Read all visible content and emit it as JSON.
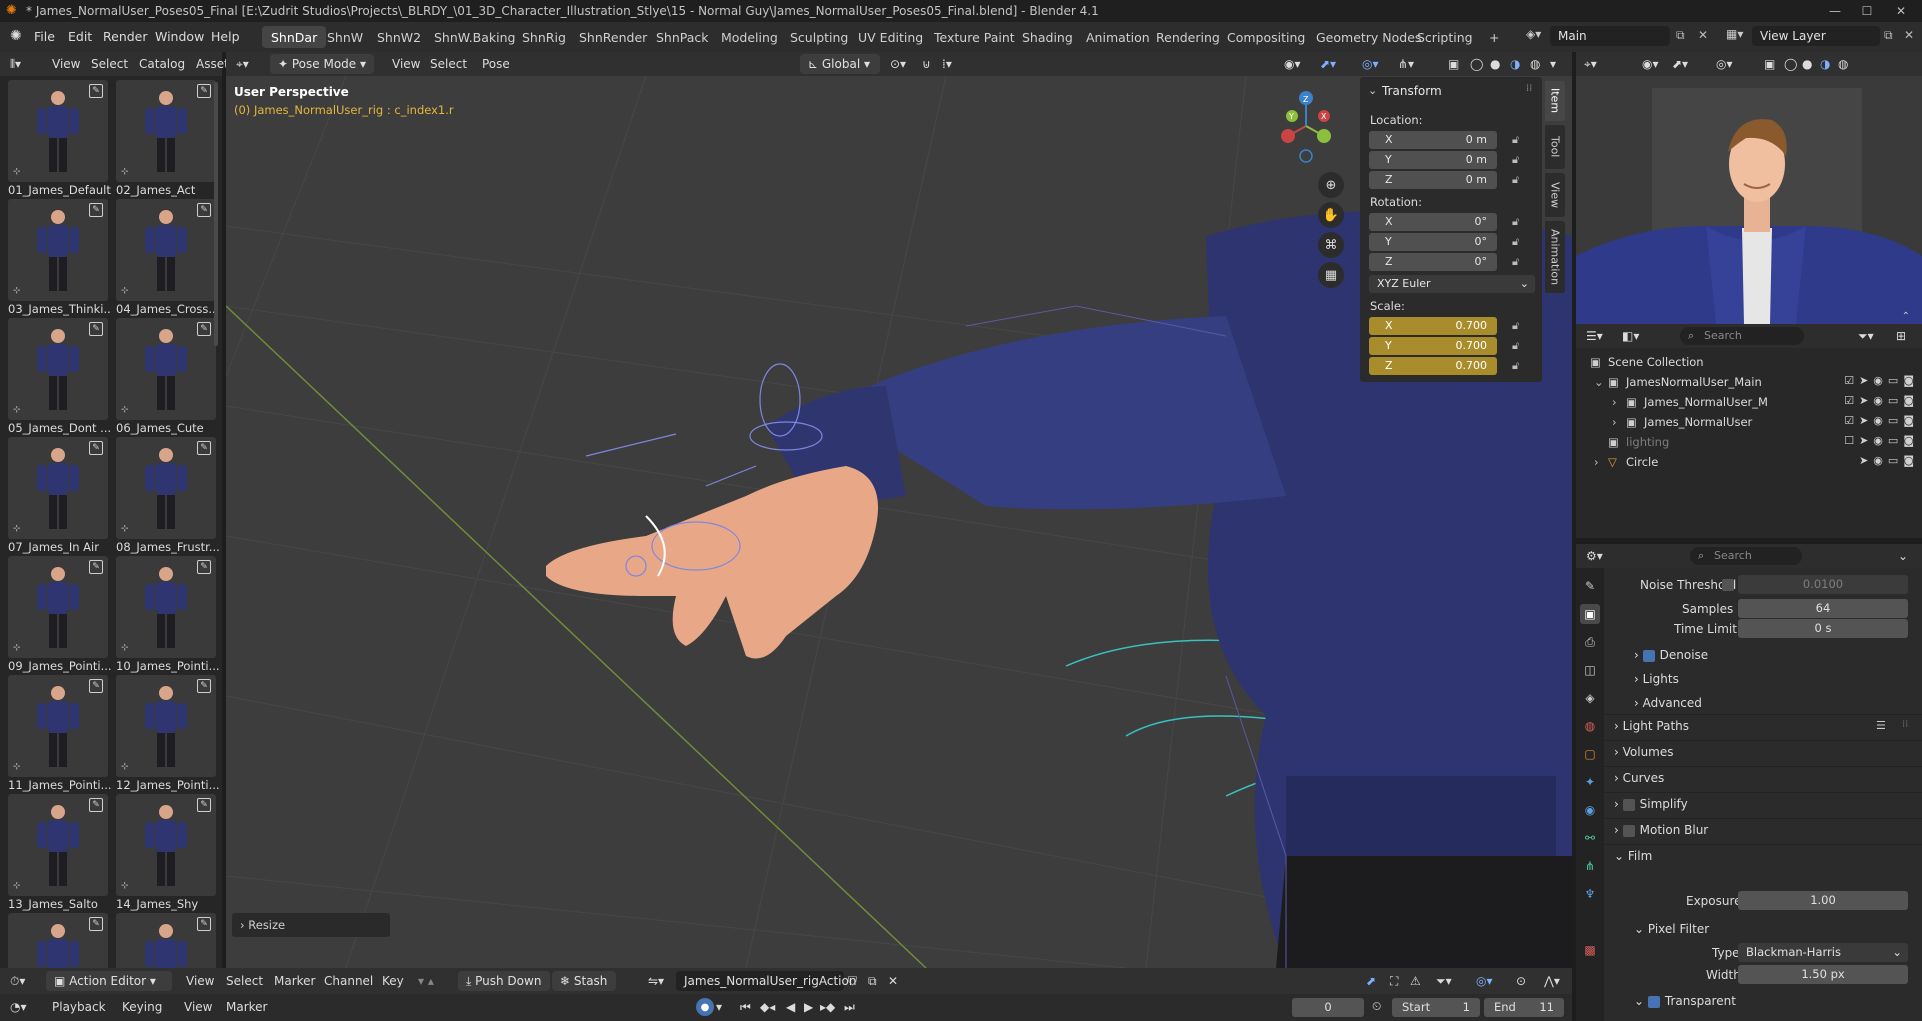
{
  "window": {
    "title": "* James_NormalUser_Poses05_Final [E:\\Zudrit Studios\\Projects\\_BLRDY_\\01_3D_Character_Illustration_Stlye\\15 - Normal Guy\\James_NormalUser_Poses05_Final.blend] - Blender 4.1",
    "min": "—",
    "max": "☐",
    "close": "✕"
  },
  "menu": [
    "File",
    "Edit",
    "Render",
    "Window",
    "Help"
  ],
  "workspaces": [
    "ShnDar",
    "ShnW",
    "ShnW2",
    "ShnW.Baking",
    "ShnRig",
    "ShnRender",
    "ShnPack",
    "Modeling",
    "Sculpting",
    "UV Editing",
    "Texture Paint",
    "Shading",
    "Animation",
    "Rendering",
    "Compositing",
    "Geometry Nodes",
    "Scripting",
    "+"
  ],
  "scene": {
    "name": "Main",
    "view_layer": "View Layer"
  },
  "asset_header": {
    "items": [
      "View",
      "Select",
      "Catalog",
      "Asset"
    ]
  },
  "viewport_header": {
    "mode": "Pose Mode",
    "items": [
      "View",
      "Select",
      "Pose"
    ],
    "orientation": "Global"
  },
  "viewport": {
    "title": "User Perspective",
    "subtitle": "(0) James_NormalUser_rig : c_index1.r",
    "resize_label": "Resize",
    "gizmo": {
      "x": "X",
      "y": "Y",
      "z": "Z"
    }
  },
  "assets": [
    "01_James_Default",
    "02_James_Act",
    "03_James_Thinki...",
    "04_James_Cross...",
    "05_James_Dont ...",
    "06_James_Cute",
    "07_James_In Air",
    "08_James_Frustr...",
    "09_James_Pointi...",
    "10_James_Pointi...",
    "11_James_Pointi...",
    "12_James_Pointi...",
    "13_James_Salto",
    "14_James_Shy",
    "",
    ""
  ],
  "transform": {
    "header": "Transform",
    "location_label": "Location:",
    "location": [
      {
        "axis": "X",
        "value": "0 m"
      },
      {
        "axis": "Y",
        "value": "0 m"
      },
      {
        "axis": "Z",
        "value": "0 m"
      }
    ],
    "rotation_label": "Rotation:",
    "rotation": [
      {
        "axis": "X",
        "value": "0°"
      },
      {
        "axis": "Y",
        "value": "0°"
      },
      {
        "axis": "Z",
        "value": "0°"
      }
    ],
    "rotation_mode": "XYZ Euler",
    "scale_label": "Scale:",
    "scale": [
      {
        "axis": "X",
        "value": "0.700"
      },
      {
        "axis": "Y",
        "value": "0.700"
      },
      {
        "axis": "Z",
        "value": "0.700"
      }
    ]
  },
  "side_tabs": [
    "Item",
    "Tool",
    "View",
    "Animation"
  ],
  "outliner": {
    "search_placeholder": "Search",
    "rows": [
      {
        "label": "Scene Collection",
        "indent": 0
      },
      {
        "label": "JamesNormalUser_Main",
        "indent": 1
      },
      {
        "label": "James_NormalUser_M",
        "indent": 2
      },
      {
        "label": "James_NormalUser",
        "indent": 2
      },
      {
        "label": "lighting",
        "indent": 1
      },
      {
        "label": "Circle",
        "indent": 1
      }
    ]
  },
  "properties": {
    "search_placeholder": "Search",
    "noise_threshold_label": "Noise Threshold",
    "noise_threshold": "0.0100",
    "samples_label": "Samples",
    "samples": "64",
    "time_limit_label": "Time Limit",
    "time_limit": "0 s",
    "denoise": "Denoise",
    "lights": "Lights",
    "advanced": "Advanced",
    "light_paths": "Light Paths",
    "volumes": "Volumes",
    "curves": "Curves",
    "simplify": "Simplify",
    "motion_blur": "Motion Blur",
    "film": "Film",
    "exposure_label": "Exposure",
    "exposure": "1.00",
    "pixel_filter": "Pixel Filter",
    "type_label": "Type",
    "type": "Blackman-Harris",
    "width_label": "Width",
    "width": "1.50 px",
    "transparent": "Transparent"
  },
  "action_editor": {
    "mode": "Action Editor",
    "items": [
      "View",
      "Select",
      "Marker",
      "Channel",
      "Key"
    ],
    "push_down": "Push Down",
    "stash": "Stash",
    "action": "James_NormalUser_rigAction"
  },
  "timeline": {
    "items": [
      "Playback",
      "Keying",
      "View",
      "Marker"
    ],
    "current_frame": "0",
    "start_label": "Start",
    "start": "1",
    "end_label": "End",
    "end": "11"
  }
}
